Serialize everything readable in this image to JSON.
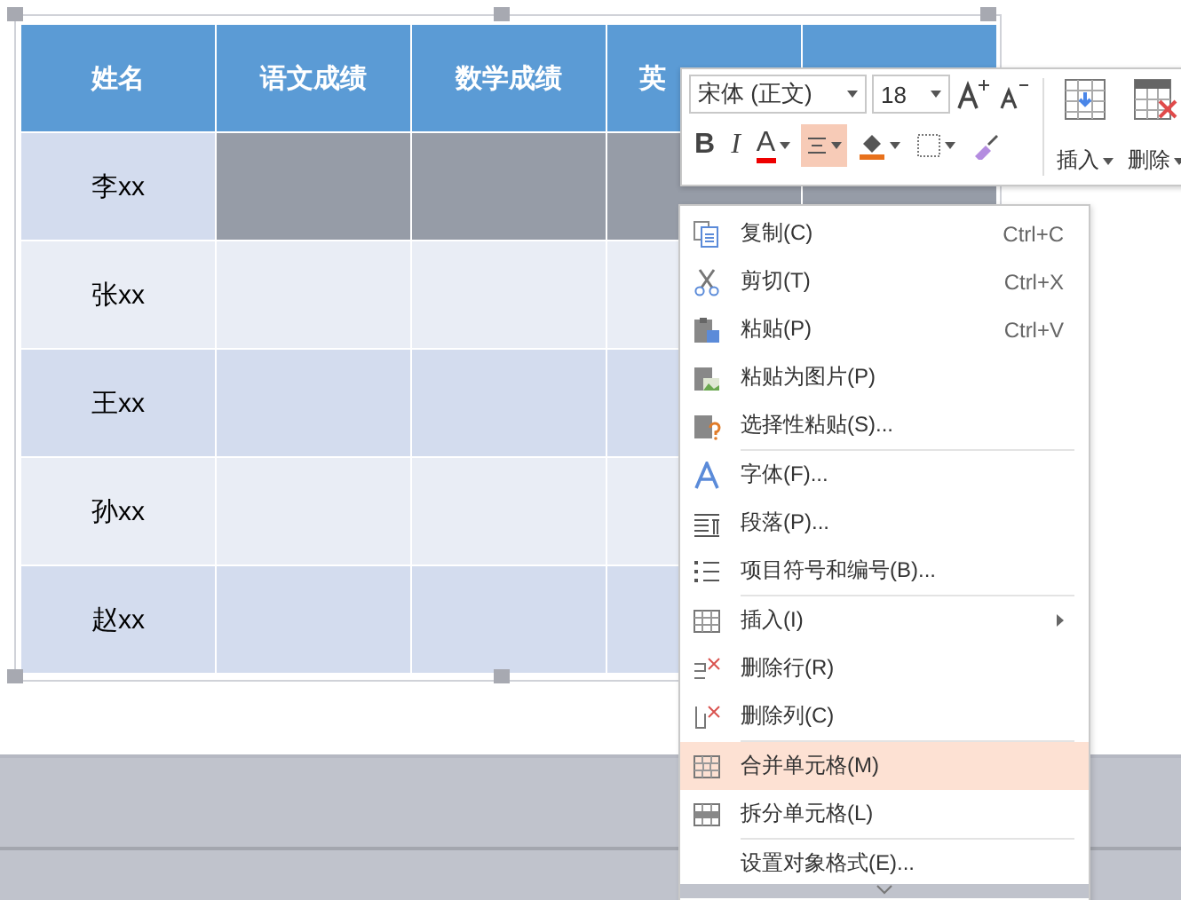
{
  "table": {
    "columns": [
      "姓名",
      "语文成绩",
      "数学成绩",
      "英"
    ],
    "rows": [
      {
        "name": "李xx",
        "selected": true
      },
      {
        "name": "张xx",
        "selected": false
      },
      {
        "name": "王xx",
        "selected": false
      },
      {
        "name": "孙xx",
        "selected": false
      },
      {
        "name": "赵xx",
        "selected": false
      }
    ]
  },
  "toolbar": {
    "font": "宋体 (正文)",
    "size": "18",
    "format_buttons": [
      {
        "kind": "bold",
        "label": "B",
        "selected": false
      },
      {
        "kind": "italic",
        "label": "I",
        "selected": false
      },
      {
        "kind": "font-color",
        "label": "A",
        "selected": false
      },
      {
        "kind": "align",
        "selected": true
      },
      {
        "kind": "fill",
        "selected": false
      },
      {
        "kind": "border",
        "selected": false
      },
      {
        "kind": "painter",
        "selected": false
      }
    ],
    "big_buttons": [
      {
        "kind": "insert",
        "label": "插入"
      },
      {
        "kind": "delete",
        "label": "删除"
      }
    ]
  },
  "context_menu": {
    "groups": [
      [
        {
          "kind": "copy",
          "label": "复制(C)",
          "shortcut": "Ctrl+C",
          "selected": false
        },
        {
          "kind": "cut",
          "label": "剪切(T)",
          "shortcut": "Ctrl+X",
          "selected": false
        },
        {
          "kind": "paste",
          "label": "粘贴(P)",
          "shortcut": "Ctrl+V",
          "selected": false
        },
        {
          "kind": "paste-picture",
          "label": "粘贴为图片(P)",
          "selected": false
        },
        {
          "kind": "paste-special",
          "label": "选择性粘贴(S)...",
          "selected": false
        }
      ],
      [
        {
          "kind": "font",
          "label": "字体(F)...",
          "selected": false
        },
        {
          "kind": "paragraph",
          "label": "段落(P)...",
          "selected": false
        },
        {
          "kind": "list",
          "label": "项目符号和编号(B)...",
          "selected": false
        }
      ],
      [
        {
          "kind": "table",
          "label": "插入(I)",
          "submenu": true,
          "selected": false
        },
        {
          "kind": "delete-row",
          "label": "删除行(R)",
          "selected": false
        },
        {
          "kind": "delete-column",
          "label": "删除列(C)",
          "selected": false
        }
      ],
      [
        {
          "kind": "merge",
          "label": "合并单元格(M)",
          "selected": true
        },
        {
          "kind": "split",
          "label": "拆分单元格(L)",
          "selected": false
        }
      ],
      [
        {
          "label": "设置对象格式(E)...",
          "selected": false
        }
      ]
    ]
  }
}
